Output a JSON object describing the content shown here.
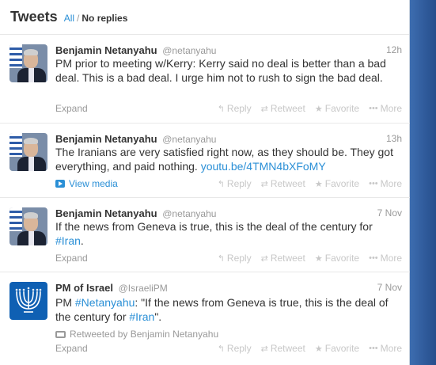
{
  "header": {
    "title": "Tweets",
    "filter_all": "All",
    "separator": "/",
    "filter_noreplies": "No replies"
  },
  "actions": {
    "reply": "Reply",
    "retweet": "Retweet",
    "favorite": "Favorite",
    "more": "More"
  },
  "tweets": [
    {
      "name": "Benjamin Netanyahu",
      "handle": "@netanyahu",
      "time": "12h",
      "text": "PM prior to meeting w/Kerry: Kerry said no deal is better than a bad deal. This is a bad deal. I urge him not to rush to sign the bad deal.",
      "bottom": "Expand"
    },
    {
      "name": "Benjamin Netanyahu",
      "handle": "@netanyahu",
      "time": "13h",
      "text": "The Iranians are very satisfied right now, as they should be. They got everything, and paid nothing.",
      "link": "youtu.be/4TMN4bXFoMY",
      "bottom": "View media"
    },
    {
      "name": "Benjamin Netanyahu",
      "handle": "@netanyahu",
      "time": "7 Nov",
      "text_before": "If the news from Geneva is true, this is the deal of the century for ",
      "hashtag": "#Iran",
      "text_after": ".",
      "bottom": "Expand"
    },
    {
      "name": "PM of Israel",
      "handle": "@IsraeliPM",
      "time": "7 Nov",
      "text_pre": "PM ",
      "hashtag1": "#Netanyahu",
      "text_mid": ": \"If the news from Geneva is true, this is the deal of the century for ",
      "hashtag2": "#Iran",
      "text_post": "\".",
      "retweeted_by": "Retweeted by Benjamin Netanyahu",
      "bottom": "Expand"
    }
  ],
  "colors": {
    "link": "#2a8fd6",
    "muted": "#999999",
    "action": "#c8c8c8",
    "side_blue": "#2f5a9a"
  }
}
